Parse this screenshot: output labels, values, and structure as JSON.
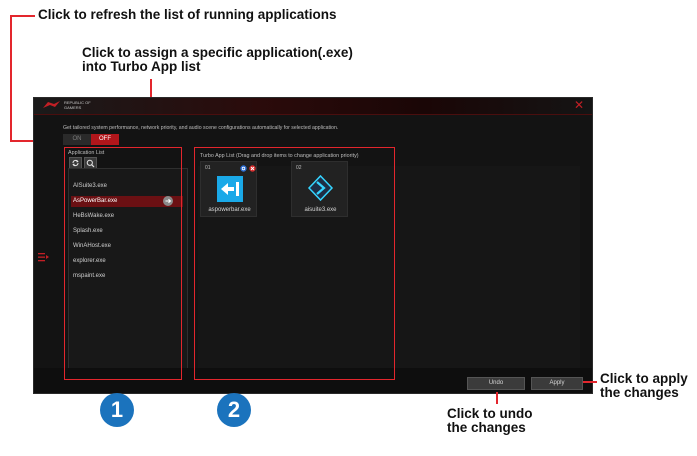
{
  "callouts": {
    "refresh": "Click to refresh the list of running applications",
    "assign_line1": "Click to assign a specific application(.exe)",
    "assign_line2": "into Turbo App list",
    "apply_line1": "Click to apply",
    "apply_line2": "the changes",
    "undo_line1": "Click to undo",
    "undo_line2": "the changes"
  },
  "app": {
    "brand_line1": "REPUBLIC OF",
    "brand_line2": "GAMERS",
    "close_glyph": "✕",
    "description": "Get tailored system performance, network priority, and audio scene configurations automatically for selected application.",
    "toggle": {
      "on_label": "ON",
      "off_label": "OFF",
      "state": "off"
    },
    "application_list": {
      "title": "Application List",
      "items": [
        "AISuite3.exe",
        "AsPowerBar.exe",
        "HeBsWake.exe",
        "Splash.exe",
        "WinAHost.exe",
        "explorer.exe",
        "mspaint.exe"
      ],
      "selected_index": 1
    },
    "turbo_list": {
      "title": "Turbo App List  (Drag and drop items to change application priority)",
      "cards": [
        {
          "number": "01",
          "name": "aspowerbar.exe"
        },
        {
          "number": "02",
          "name": "aisuite3.exe"
        }
      ]
    },
    "buttons": {
      "undo": "Undo",
      "apply": "Apply"
    }
  },
  "badges": [
    "1",
    "2"
  ],
  "colors": {
    "accent_red": "#e3262d",
    "rog_red": "#b2161b",
    "badge_blue": "#1b73bd",
    "window_bg": "#131313"
  },
  "icons": [
    "refresh-icon",
    "search-icon",
    "add-arrow-icon",
    "close-icon",
    "sidebar-menu-icon",
    "rog-logo",
    "info-icon",
    "remove-icon",
    "aspowerbar-app-icon",
    "aisuite3-app-icon"
  ]
}
